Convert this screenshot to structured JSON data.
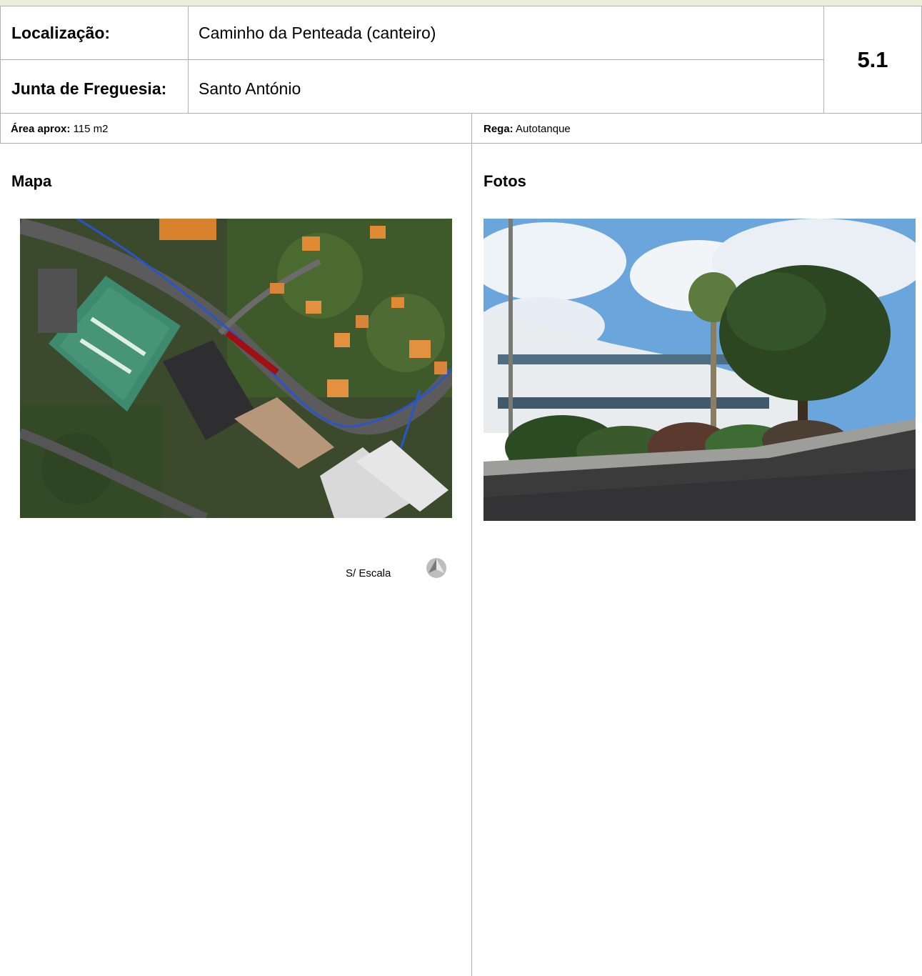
{
  "header": {
    "location_label": "Localização:",
    "location_value": "Caminho da Penteada (canteiro)",
    "parish_label": "Junta de Freguesia:",
    "parish_value": "Santo António",
    "code": "5.1"
  },
  "info": {
    "area_label": "Área aprox:",
    "area_value": "115 m2",
    "irrigation_label": "Rega:",
    "irrigation_value": "Autotanque"
  },
  "map_section": {
    "title": "Mapa",
    "scale_label": "S/ Escala",
    "north_icon": "north-arrow-icon"
  },
  "photo_section": {
    "title": "Fotos"
  }
}
